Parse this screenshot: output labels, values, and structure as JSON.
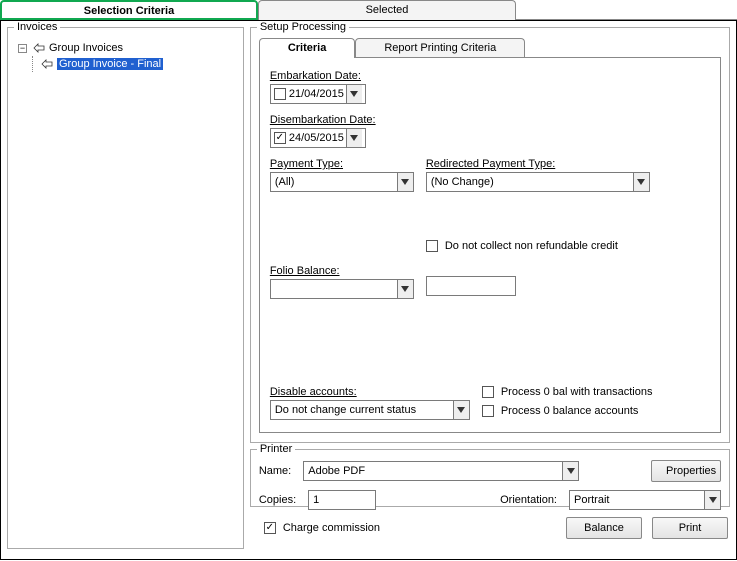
{
  "top_tabs": {
    "selection": "Selection Criteria",
    "selected": "Selected"
  },
  "invoices": {
    "legend": "Invoices",
    "root": "Group Invoices",
    "child": "Group Invoice - Final"
  },
  "setup": {
    "legend": "Setup Processing",
    "tabs": {
      "criteria": "Criteria",
      "report": "Report Printing Criteria"
    },
    "embark_lbl": "Embarkation Date:",
    "embark_val": "21/04/2015",
    "embark_checked": false,
    "disembark_lbl": "Disembarkation Date:",
    "disembark_val": "24/05/2015",
    "disembark_checked": true,
    "payment_lbl": "Payment Type:",
    "payment_val": "(All)",
    "redirect_lbl": "Redirected Payment Type:",
    "redirect_val": "(No Change)",
    "folio_lbl": "Folio Balance:",
    "folio_val": "",
    "folio_text": "",
    "no_collect_lbl": "Do not collect non refundable credit",
    "disable_lbl": "Disable accounts:",
    "disable_val": "Do not change current status",
    "proc0trans_lbl": "Process 0 bal with transactions",
    "proc0acct_lbl": "Process 0 balance accounts"
  },
  "printer": {
    "legend": "Printer",
    "name_lbl": "Name:",
    "name_val": "Adobe PDF",
    "props_btn": "Properties",
    "copies_lbl": "Copies:",
    "copies_val": "1",
    "orient_lbl": "Orientation:",
    "orient_val": "Portrait"
  },
  "bottom": {
    "charge_lbl": "Charge commission",
    "charge_checked": true,
    "balance_btn": "Balance",
    "print_btn": "Print"
  }
}
